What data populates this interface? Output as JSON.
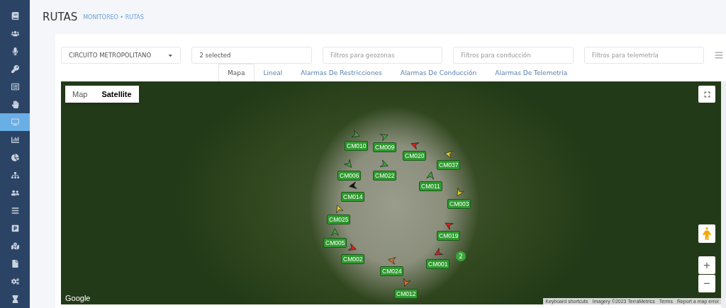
{
  "sidebar": {
    "items": [
      {
        "selected": false
      },
      {
        "selected": false
      },
      {
        "selected": false
      },
      {
        "selected": false
      },
      {
        "selected": false
      },
      {
        "selected": false
      },
      {
        "selected": true
      },
      {
        "selected": false
      },
      {
        "selected": false
      },
      {
        "selected": false
      },
      {
        "selected": false
      },
      {
        "selected": false
      },
      {
        "selected": false
      },
      {
        "selected": false
      },
      {
        "selected": false
      },
      {
        "selected": false
      },
      {
        "selected": false
      }
    ]
  },
  "header": {
    "title": "RUTAS",
    "breadcrumb": [
      "MONITOREO",
      "RUTAS"
    ],
    "separator": "•"
  },
  "filters": {
    "route": "CIRCUITO METROPOLITANO",
    "vehicles": "2 selected",
    "fields": [
      {
        "placeholder": "Filtros para geozonas"
      },
      {
        "placeholder": "Filtros para conducción"
      },
      {
        "placeholder": "Filtros para telemetría"
      }
    ]
  },
  "tabs": [
    {
      "label": "Mapa",
      "selected": true
    },
    {
      "label": "Lineal",
      "selected": false
    },
    {
      "label": "Alarmas De Restricciones",
      "selected": false
    },
    {
      "label": "Alarmas De Conducción",
      "selected": false
    },
    {
      "label": "Alarmas De Telemetría",
      "selected": false
    }
  ],
  "map": {
    "types": [
      {
        "label": "Map",
        "selected": false
      },
      {
        "label": "Satellite",
        "selected": true
      }
    ],
    "vehicles": [
      {
        "label": "CM010",
        "color": "#3aa83a"
      },
      {
        "label": "CM009",
        "color": "#3aa83a"
      },
      {
        "label": "CM020",
        "color": "#d42020"
      },
      {
        "label": "CM037",
        "color": "#e0d020"
      },
      {
        "label": "CM006",
        "color": "#3aa83a"
      },
      {
        "label": "CM022",
        "color": "#3aa83a"
      },
      {
        "label": "CM011",
        "color": "#3aa83a"
      },
      {
        "label": "CM014",
        "color": "#111111"
      },
      {
        "label": "CM003",
        "color": "#e0d020"
      },
      {
        "label": "CM025",
        "color": "#e0d020"
      },
      {
        "label": "CM019",
        "color": "#d42020"
      },
      {
        "label": "CM005",
        "color": "#3aa83a"
      },
      {
        "label": "CM002",
        "color": "#d42020"
      },
      {
        "label": "CM001",
        "color": "#d42020"
      },
      {
        "label": "CM024",
        "color": "#e07020"
      },
      {
        "label": "CM012",
        "color": "#e07020"
      }
    ],
    "cluster": "2",
    "zoom_in": "+",
    "zoom_out": "−",
    "logo": "Google",
    "attribution": [
      "Keyboard shortcuts",
      "Imagery ©2023 TerraMetrics",
      "Terms",
      "Report a map error"
    ]
  }
}
